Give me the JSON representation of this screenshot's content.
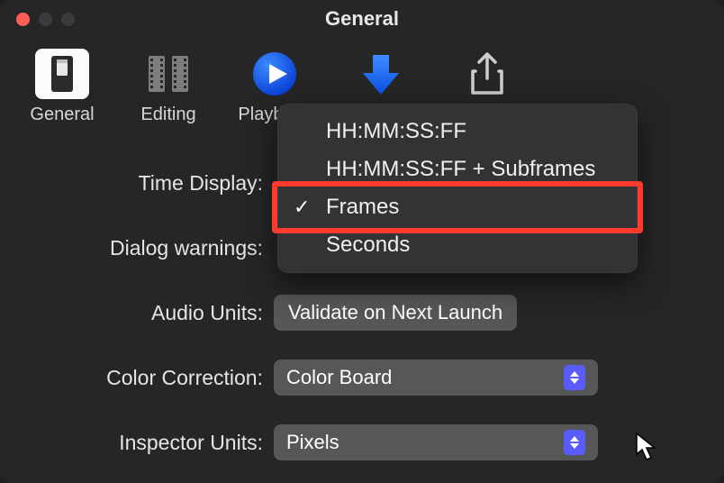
{
  "window": {
    "title": "General"
  },
  "toolbar": {
    "general": "General",
    "editing": "Editing",
    "playback": "Playback",
    "import": "Import",
    "destinations": "Destinations"
  },
  "form": {
    "time_display_label": "Time Display:",
    "dialog_warnings_label": "Dialog warnings:",
    "audio_units_label": "Audio Units:",
    "audio_units_button": "Validate on Next Launch",
    "color_correction_label": "Color Correction:",
    "color_correction_value": "Color Board",
    "inspector_units_label": "Inspector Units:",
    "inspector_units_value": "Pixels"
  },
  "dropdown": {
    "items": [
      {
        "label": "HH:MM:SS:FF",
        "checked": false
      },
      {
        "label": "HH:MM:SS:FF + Subframes",
        "checked": false
      },
      {
        "label": "Frames",
        "checked": true
      },
      {
        "label": "Seconds",
        "checked": false
      }
    ]
  }
}
